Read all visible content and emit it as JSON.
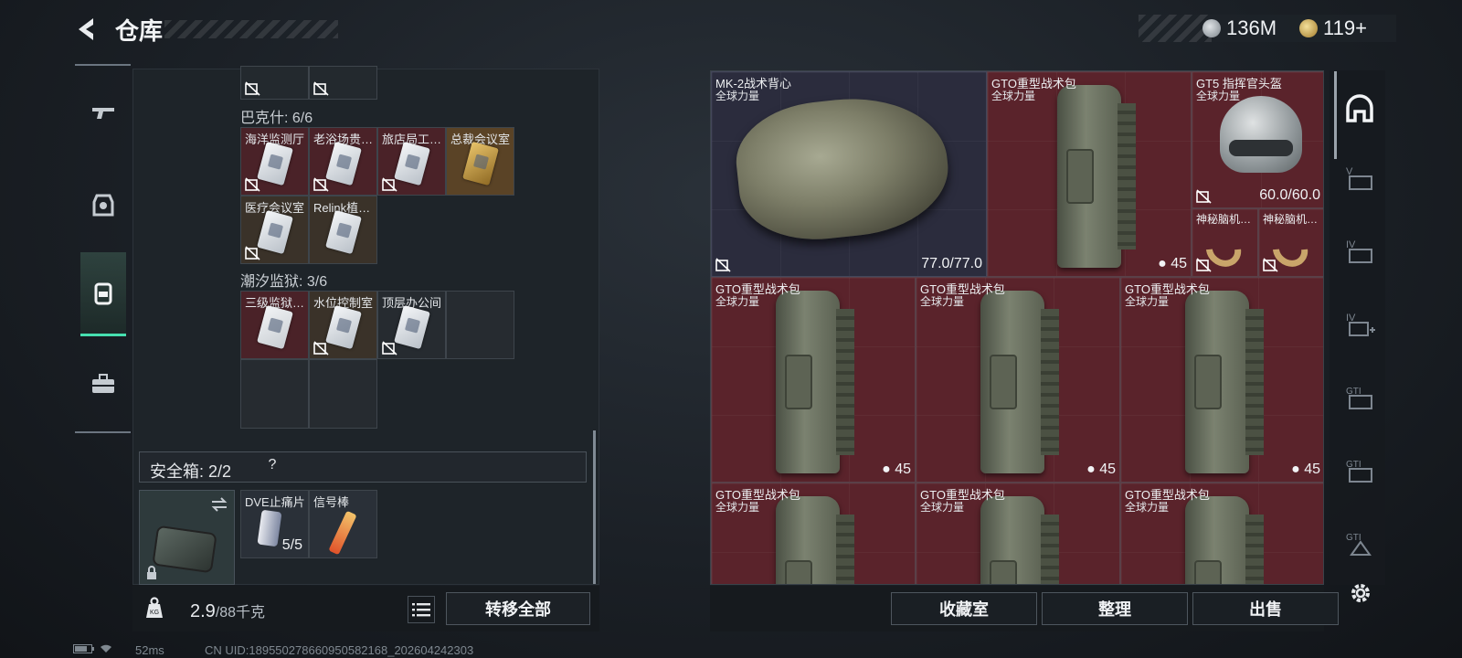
{
  "header": {
    "title": "仓库",
    "currency_silver": "136M",
    "currency_gold": "119+"
  },
  "left": {
    "section_bakshi": "巴克什: 6/6",
    "section_tide": "潮汐监狱: 3/6",
    "cards_bakshi": [
      {
        "name": "海洋监测厅",
        "color": "red"
      },
      {
        "name": "老浴场贵…",
        "color": "red"
      },
      {
        "name": "旅店局工…",
        "color": "red"
      },
      {
        "name": "总裁会议室",
        "color": "gold"
      },
      {
        "name": "医疗会议室",
        "color": "brown"
      },
      {
        "name": "Relink植…",
        "color": "brown"
      }
    ],
    "cards_tide": [
      {
        "name": "三级监狱…",
        "color": "red"
      },
      {
        "name": "水位控制室",
        "color": "brown"
      },
      {
        "name": "顶层办公间",
        "color": "dark"
      }
    ],
    "safebox_label": "安全箱: 2/2",
    "safebox_help": "?",
    "safebox_items": [
      {
        "name": "DVE止痛片",
        "count": "5/5"
      },
      {
        "name": "信号棒",
        "count": ""
      }
    ],
    "weight_value": "2.9",
    "weight_max": "/88千克",
    "transfer_all": "转移全部"
  },
  "right": {
    "items": [
      {
        "name": "MK-2战术背心",
        "sub": "全球力量",
        "durability": "77.0/77.0"
      },
      {
        "name": "GTO重型战术包",
        "sub": "全球力量",
        "count": "45"
      },
      {
        "name": "GT5 指挥官头盔",
        "sub": "全球力量",
        "durability": "60.0/60.0"
      },
      {
        "name": "神秘脑机…",
        "sub": ""
      },
      {
        "name": "神秘脑机…",
        "sub": ""
      },
      {
        "name": "GTO重型战术包",
        "sub": "全球力量",
        "count": "45"
      },
      {
        "name": "GTO重型战术包",
        "sub": "全球力量",
        "count": "45"
      },
      {
        "name": "GTO重型战术包",
        "sub": "全球力量",
        "count": "45"
      },
      {
        "name": "GTO重型战术包",
        "sub": "全球力量"
      },
      {
        "name": "GTO重型战术包",
        "sub": "全球力量"
      },
      {
        "name": "GTO重型战术包",
        "sub": "全球力量"
      }
    ],
    "buttons": {
      "collection": "收藏室",
      "sort": "整理",
      "sell": "出售"
    },
    "rail_labels": [
      "V",
      "IV",
      "IV",
      "GTI",
      "GTI",
      "GTI"
    ]
  },
  "status": {
    "ping": "52ms",
    "uid": "CN UID:1895502786609505821​68_202604242303"
  },
  "colors": {
    "accent": "#46e0b0",
    "item_red": "#5a232b",
    "item_blue": "#2b2c3d"
  }
}
